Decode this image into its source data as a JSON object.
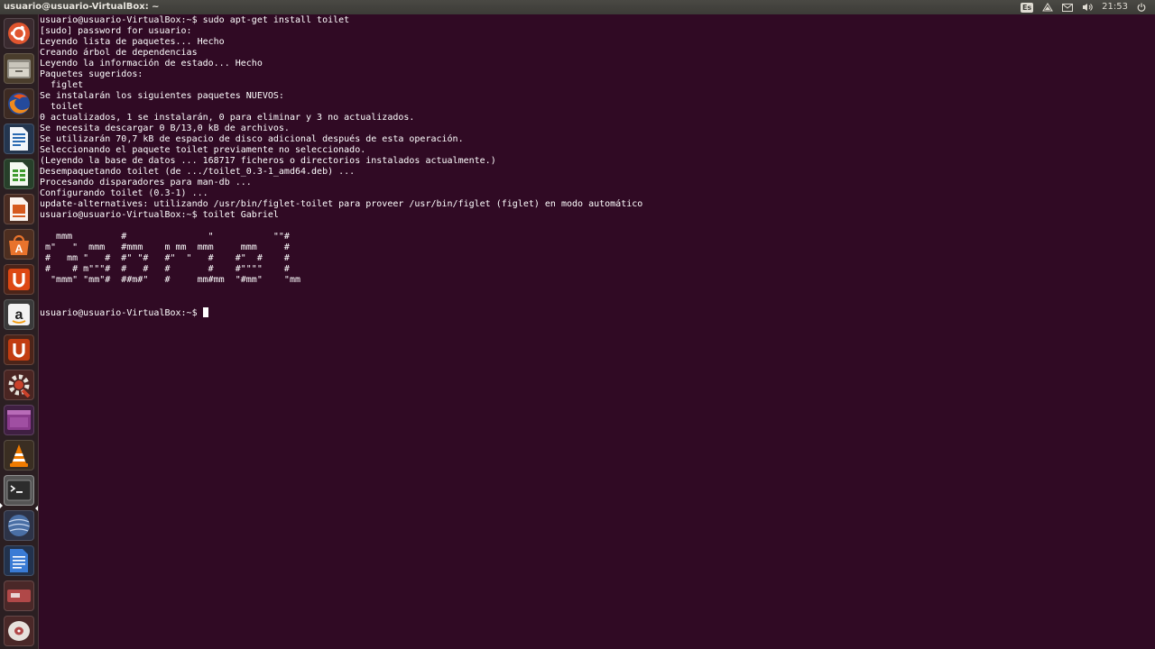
{
  "topbar": {
    "title": "usuario@usuario-VirtualBox: ~",
    "keyboard_layout": "Es",
    "clock": "21:53",
    "icons": [
      "keyboard-icon",
      "network-icon",
      "mail-icon",
      "volume-icon",
      "power-icon"
    ]
  },
  "launcher": {
    "items": [
      {
        "name": "dash-icon",
        "color": "#e0552f"
      },
      {
        "name": "files-icon",
        "color": "#8b6a3e"
      },
      {
        "name": "firefox-icon",
        "color": "#e66000"
      },
      {
        "name": "writer-icon",
        "color": "#2a6ab2"
      },
      {
        "name": "calc-icon",
        "color": "#3e9a2e"
      },
      {
        "name": "impress-icon",
        "color": "#d55a1f"
      },
      {
        "name": "software-center-icon",
        "color": "#e8732c"
      },
      {
        "name": "ubuntu-one-icon",
        "color": "#dd4814"
      },
      {
        "name": "amazon-icon",
        "color": "#e6e6e6"
      },
      {
        "name": "ubuntu-one-music-icon",
        "color": "#dd4814"
      },
      {
        "name": "system-settings-icon",
        "color": "#c9412a"
      },
      {
        "name": "workspace-switcher-icon",
        "color": "#8a3a8c"
      },
      {
        "name": "vlc-icon",
        "color": "#f07b00"
      },
      {
        "name": "terminal-icon",
        "color": "#3a3a3a"
      },
      {
        "name": "globe-app-icon",
        "color": "#4a6fa5"
      },
      {
        "name": "text-editor-icon",
        "color": "#3a7bd5"
      },
      {
        "name": "removable-drive-icon",
        "color": "#b04848"
      },
      {
        "name": "optical-drive-icon",
        "color": "#b04848"
      }
    ]
  },
  "terminal": {
    "lines": [
      "usuario@usuario-VirtualBox:~$ sudo apt-get install toilet",
      "[sudo] password for usuario:",
      "Leyendo lista de paquetes... Hecho",
      "Creando árbol de dependencias",
      "Leyendo la información de estado... Hecho",
      "Paquetes sugeridos:",
      "  figlet",
      "Se instalarán los siguientes paquetes NUEVOS:",
      "  toilet",
      "0 actualizados, 1 se instalarán, 0 para eliminar y 3 no actualizados.",
      "Se necesita descargar 0 B/13,0 kB de archivos.",
      "Se utilizarán 70,7 kB de espacio de disco adicional después de esta operación.",
      "Seleccionando el paquete toilet previamente no seleccionado.",
      "(Leyendo la base de datos ... 168717 ficheros o directorios instalados actualmente.)",
      "Desempaquetando toilet (de .../toilet_0.3-1_amd64.deb) ...",
      "Procesando disparadores para man-db ...",
      "Configurando toilet (0.3-1) ...",
      "update-alternatives: utilizando /usr/bin/figlet-toilet para proveer /usr/bin/figlet (figlet) en modo automático",
      "usuario@usuario-VirtualBox:~$ toilet Gabriel",
      "",
      "   mmm         #               \"           \"\"#",
      " m\"   \"  mmm   #mmm    m mm  mmm     mmm     #",
      " #   mm \"   #  #\" \"#   #\"  \"   #    #\"  #    #",
      " #    # m\"\"\"#  #   #   #       #    #\"\"\"\"    #",
      "  \"mmm\" \"mm\"#  ##m#\"   #     mm#mm  \"#mm\"    \"mm",
      "",
      ""
    ],
    "prompt": "usuario@usuario-VirtualBox:~$ "
  }
}
